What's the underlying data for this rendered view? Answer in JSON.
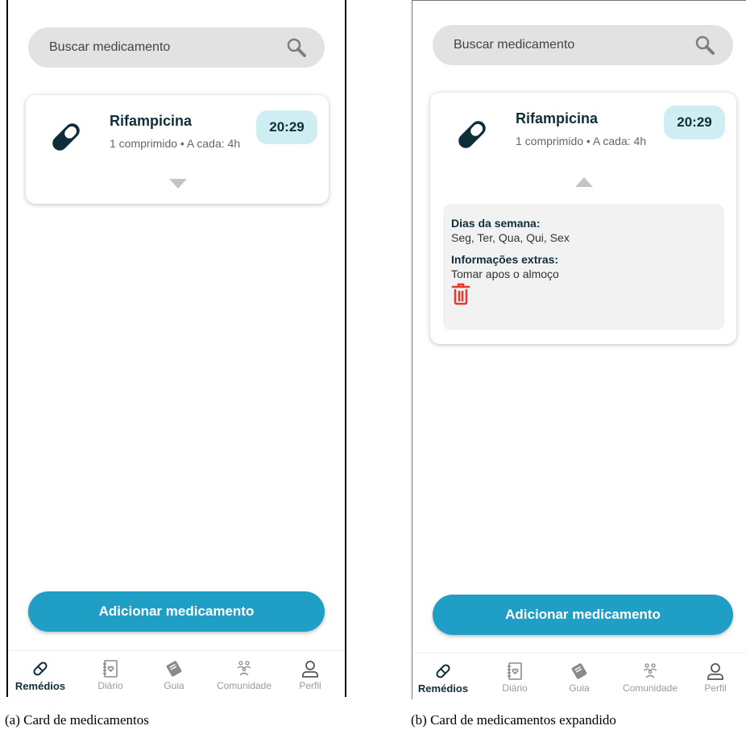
{
  "colors": {
    "accent": "#1f9fc6",
    "badge": "#cfeef4",
    "delete": "#e53935",
    "dark": "#0f2e3a"
  },
  "screen_a": {
    "search": {
      "placeholder": "Buscar medicamento",
      "icon": "search-icon"
    },
    "card": {
      "icon": "pill-icon",
      "name": "Rifampicina",
      "detail": "1 comprimido • A cada: 4h",
      "time": "20:29",
      "toggle": "chevron-down-icon"
    },
    "add_button": "Adicionar medicamento",
    "nav": [
      {
        "label": "Remédios",
        "icon": "pill-icon",
        "active": true
      },
      {
        "label": "Diário",
        "icon": "journal-icon",
        "active": false
      },
      {
        "label": "Guia",
        "icon": "book-icon",
        "active": false
      },
      {
        "label": "Comunidade",
        "icon": "community-icon",
        "active": false
      },
      {
        "label": "Perfil",
        "icon": "profile-icon",
        "active": false
      }
    ]
  },
  "screen_b": {
    "search": {
      "placeholder": "Buscar medicamento",
      "icon": "search-icon"
    },
    "card": {
      "icon": "pill-icon",
      "name": "Rifampicina",
      "detail": "1 comprimido • A cada: 4h",
      "time": "20:29",
      "toggle": "chevron-up-icon",
      "details": {
        "days_label": "Dias da semana:",
        "days_value": "Seg, Ter, Qua, Qui, Sex",
        "extra_label": "Informações extras:",
        "extra_value": "Tomar apos o almoço",
        "delete_icon": "trash-icon"
      }
    },
    "add_button": "Adicionar medicamento",
    "nav": [
      {
        "label": "Remédios",
        "icon": "pill-icon",
        "active": true
      },
      {
        "label": "Diário",
        "icon": "journal-icon",
        "active": false
      },
      {
        "label": "Guia",
        "icon": "book-icon",
        "active": false
      },
      {
        "label": "Comunidade",
        "icon": "community-icon",
        "active": false
      },
      {
        "label": "Perfil",
        "icon": "profile-icon",
        "active": false
      }
    ]
  },
  "captions": {
    "a": "(a) Card de medicamentos",
    "b": "(b) Card de medicamentos expandido"
  }
}
